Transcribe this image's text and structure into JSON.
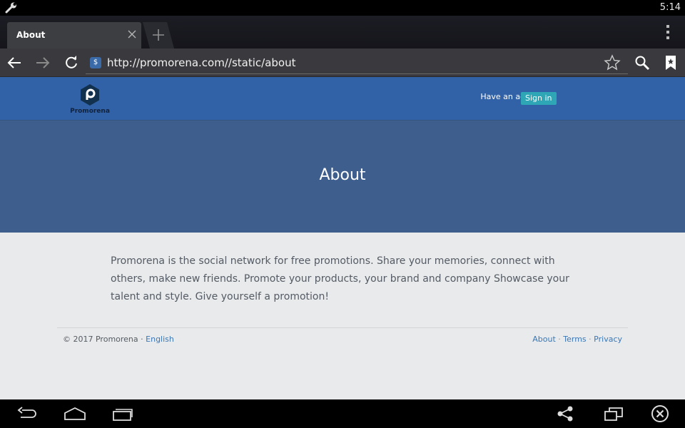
{
  "status_bar": {
    "time": "5:14"
  },
  "browser": {
    "tab": {
      "title": "About"
    },
    "url": "http://promorena.com//static/about"
  },
  "site": {
    "logo_name": "Promorena",
    "header": {
      "account_prompt": "Have an account?",
      "signin_label": "Sign in"
    },
    "hero_title": "About",
    "body_text": "Promorena is the social network for free promotions. Share your memories, connect with others, make new friends. Promote your products, your brand and company Showcase your talent and style. Give yourself a promotion!",
    "footer": {
      "copyright": "© 2017 Promorena · ",
      "language": "English",
      "links": {
        "about": "About",
        "terms": "Terms",
        "privacy": "Privacy",
        "sep": " · "
      }
    }
  },
  "colors": {
    "header_blue": "#3161a6",
    "hero_blue": "#3e5f8e",
    "signin_teal": "#2fa6b6",
    "link_blue": "#3b77b5"
  }
}
